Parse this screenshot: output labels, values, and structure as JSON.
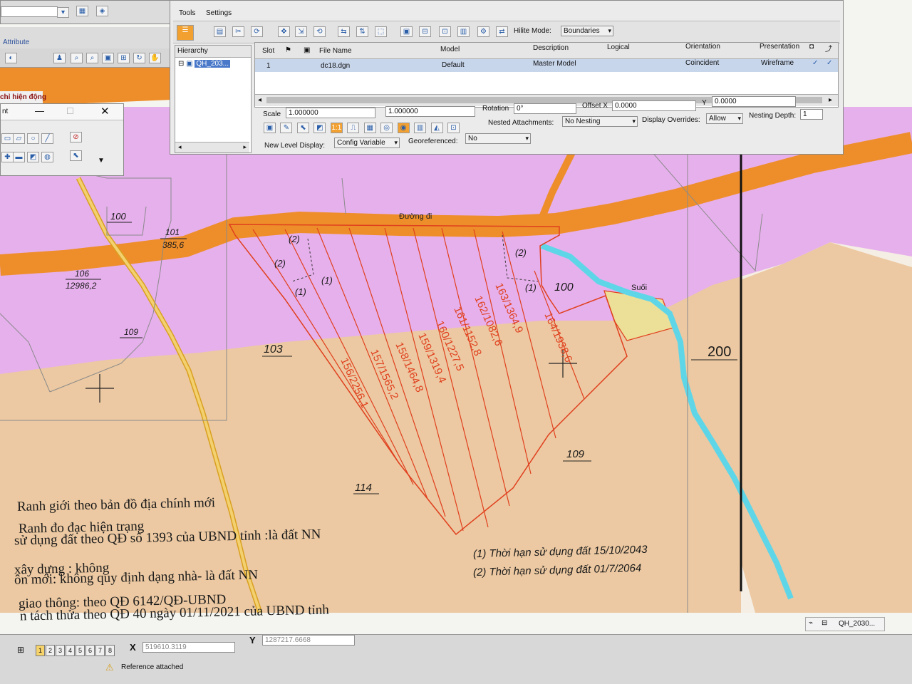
{
  "map": {
    "road_label": "Đường đi",
    "stream_label": "Suối",
    "parcel_labels": [
      "100",
      "101",
      "385,6",
      "106",
      "12986,2",
      "109",
      "103",
      "114",
      "109",
      "100",
      "200"
    ],
    "strip_labels": [
      "156/2256,1",
      "157/1565,2",
      "158/1464,8",
      "159/1319,4",
      "160/1227,5",
      "161/1152,8",
      "162/1082,6",
      "163/1364,9",
      "164/1938,6"
    ],
    "zone_markers": [
      "(2)",
      "(2)",
      "(1)",
      "(1)",
      "(2)",
      "(1)"
    ],
    "colors": {
      "residential": "#e6b0ec",
      "agriculture": "#ecc9a2",
      "road": "#ee8e2a",
      "stream": "#5fd6e8",
      "boundary": "#e0401e",
      "highlight": "#ecdf98"
    }
  },
  "legend": [
    "Ranh giới theo bản đồ địa chính mới",
    "Ranh đo đạc hiện trạng",
    "sử dụng đất theo QĐ số 1393 của UBND tỉnh :là đất NN",
    "xây dựng : không",
    "ôn mới: không quy định dạng nhà- là đất NN",
    "giao thông: theo QĐ 6142/QĐ-UBND",
    "n tách thửa theo QĐ 40 ngày 01/11/2021 của UBND tỉnh"
  ],
  "notes": [
    "(1) Thời hạn sử dụng đất 15/10/2043",
    "(2) Thời hạn sử dụng đất 01/7/2064"
  ],
  "ref_dialog": {
    "menu": [
      "Tools",
      "Settings"
    ],
    "hilite_label": "Hilite Mode:",
    "hilite_value": "Boundaries",
    "tree_header": "Hierarchy",
    "tree_item": "QH_203...",
    "columns": [
      "Slot",
      "File Name",
      "Model",
      "Description",
      "Logical",
      "Orientation",
      "Presentation"
    ],
    "row": {
      "slot": "1",
      "file": "dc18.dgn",
      "model": "Default",
      "description": "Master Model",
      "logical": "",
      "orientation": "Coincident",
      "presentation": "Wireframe"
    },
    "scale_label": "Scale",
    "scale_1": "1.000000",
    "scale_2": "1.000000",
    "rotation_label": "Rotation",
    "rotation_value": "0°",
    "offset_x_label": "Offset X",
    "offset_x_value": "0.0000",
    "offset_y_label": "Y",
    "offset_y_value": "0.0000",
    "nested_label": "Nested Attachments:",
    "nested_value": "No Nesting",
    "display_overrides_label": "Display Overrides:",
    "display_overrides_value": "Allow",
    "nesting_depth_label": "Nesting Depth:",
    "nesting_depth_value": "1",
    "new_level_label": "New Level Display:",
    "new_level_value": "Config Variable",
    "georef_label": "Georeferenced:",
    "georef_value": "No"
  },
  "small_window": {
    "title": "nt"
  },
  "top_left_partial": "Attribute",
  "sidebar_partial": "chỉ hiện động",
  "status": {
    "views": [
      "1",
      "2",
      "3",
      "4",
      "5",
      "6",
      "7",
      "8"
    ],
    "x_label": "X",
    "x_value": "519610.3119",
    "y_label": "Y",
    "y_value": "1287217.6668",
    "message": "Reference attached",
    "model_name": "QH_2030..."
  }
}
